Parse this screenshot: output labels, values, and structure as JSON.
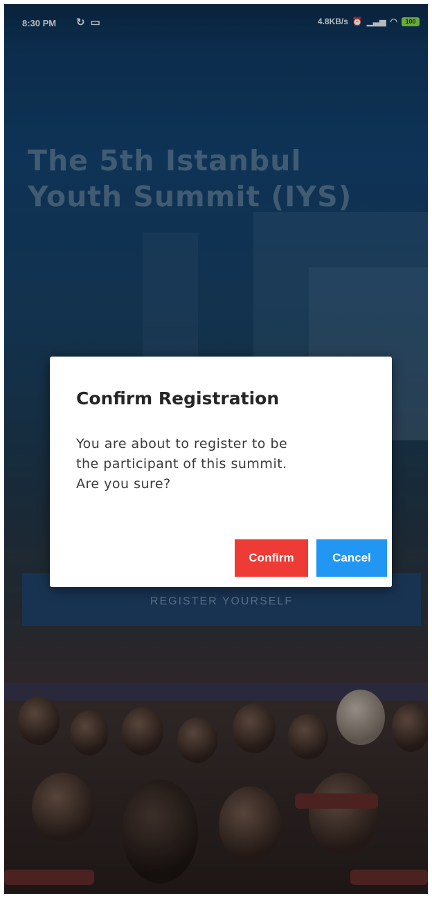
{
  "status_bar": {
    "time": "8:30 PM",
    "network_speed": "4.8KB/s",
    "battery": "100"
  },
  "hero": {
    "title_line1": "The 5th Istanbul",
    "title_line2": "Youth Summit (IYS)"
  },
  "register_button": {
    "label": "REGISTER YOURSELF"
  },
  "dialog": {
    "title": "Confirm Registration",
    "message_line1": "You are about to register to be",
    "message_line2": "the participant of this summit.",
    "message_line3": "Are you sure?",
    "confirm_label": "Confirm",
    "cancel_label": "Cancel"
  },
  "colors": {
    "confirm": "#ef3b36",
    "cancel": "#2196f3",
    "header_bg": "#123f69"
  },
  "icons": [
    "sync-icon",
    "cast-icon",
    "alarm-icon",
    "signal-icon",
    "wifi-icon",
    "battery-icon"
  ]
}
